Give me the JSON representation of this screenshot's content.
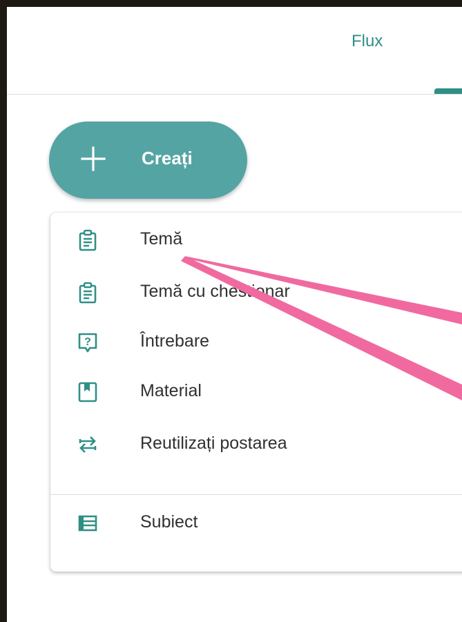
{
  "header": {
    "tab_label": "Flux"
  },
  "create_button": {
    "label": "Creați",
    "icon": "plus-icon"
  },
  "menu": {
    "items": [
      {
        "label": "Temă",
        "icon": "assignment-icon"
      },
      {
        "label": "Temă cu chestionar",
        "icon": "quiz-assignment-icon"
      },
      {
        "label": "Întrebare",
        "icon": "question-icon"
      },
      {
        "label": "Material",
        "icon": "material-icon"
      },
      {
        "label": "Reutilizați postarea",
        "icon": "reuse-icon"
      }
    ],
    "footer_item": {
      "label": "Subiect",
      "icon": "topic-icon"
    }
  },
  "colors": {
    "accent": "#2f8f86",
    "button": "#55a4a4",
    "annotation": "#f06aa0",
    "frame": "#1e1a13"
  }
}
